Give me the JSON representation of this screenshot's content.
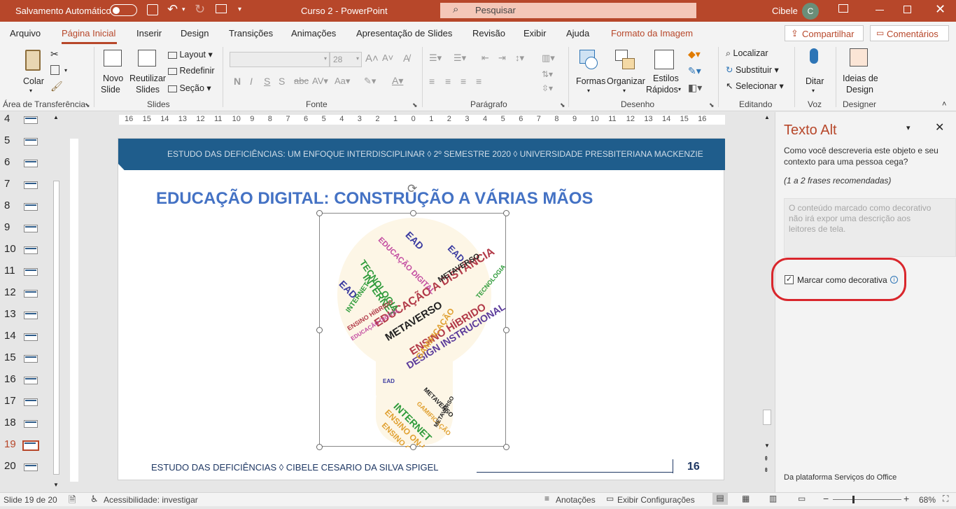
{
  "titlebar": {
    "autosave_label": "Salvamento Automático",
    "doc_title": "Curso 2  -  PowerPoint",
    "search_placeholder": "Pesquisar",
    "user_name": "Cibele",
    "user_initial": "C"
  },
  "tabs": [
    "Arquivo",
    "Página Inicial",
    "Inserir",
    "Design",
    "Transições",
    "Animações",
    "Apresentação de Slides",
    "Revisão",
    "Exibir",
    "Ajuda",
    "Formato da Imagem"
  ],
  "share_label": "Compartilhar",
  "comments_label": "Comentários",
  "ribbon": {
    "colar": "Colar",
    "novo_slide_1": "Novo",
    "novo_slide_2": "Slide",
    "reutilizar_1": "Reutilizar",
    "reutilizar_2": "Slides",
    "layout": "Layout",
    "redefinir": "Redefinir",
    "secao": "Seção",
    "font_size": "28",
    "formas": "Formas",
    "organizar": "Organizar",
    "estilos_1": "Estilos",
    "estilos_2": "Rápidos",
    "localizar": "Localizar",
    "substituir": "Substituir",
    "selecionar": "Selecionar",
    "ditar": "Ditar",
    "ideias_1": "Ideias de",
    "ideias_2": "Design",
    "groups": {
      "clipboard": "Área de Transferência",
      "slides": "Slides",
      "fonte": "Fonte",
      "paragrafo": "Parágrafo",
      "desenho": "Desenho",
      "editando": "Editando",
      "voz": "Voz",
      "designer": "Designer"
    }
  },
  "thumbnails": [
    "4",
    "5",
    "6",
    "7",
    "8",
    "9",
    "10",
    "11",
    "12",
    "13",
    "14",
    "15",
    "16",
    "17",
    "18",
    "19",
    "20"
  ],
  "active_slide": "19",
  "slide": {
    "header": "ESTUDO DAS DEFICIÊNCIAS: UM ENFOQUE INTERDISCIPLINAR  ◊  2º SEMESTRE 2020  ◊  UNIVERSIDADE PRESBITERIANA MACKENZIE",
    "title": "EDUCAÇÃO DIGITAL: CONSTRUÇÃO A VÁRIAS MÃOS",
    "footer": "ESTUDO DAS DEFICIÊNCIAS ◊  CIBELE CESARIO DA SILVA SPIGEL",
    "page_number": "16",
    "words": [
      "EDUCAÇÃO A DISTÂNCIA",
      "METAVERSO",
      "ENSINO HÍBRIDO",
      "DESIGN INSTRUCIONAL",
      "TECNOLOGIA",
      "INTERNET",
      "EAD",
      "GAMIFICAÇÃO",
      "ENSINO ON-LINE",
      "EDUCAÇÃO DIGITAL"
    ]
  },
  "ruler_numbers": [
    "16",
    "15",
    "14",
    "13",
    "12",
    "11",
    "10",
    "9",
    "8",
    "7",
    "6",
    "5",
    "4",
    "3",
    "2",
    "1",
    "0",
    "1",
    "2",
    "3",
    "4",
    "5",
    "6",
    "7",
    "8",
    "9",
    "10",
    "11",
    "12",
    "13",
    "14",
    "15",
    "16"
  ],
  "alt_pane": {
    "title": "Texto Alt",
    "question": "Como você descreveria este objeto e seu contexto para uma pessoa cega?",
    "hint": "(1 a 2 frases recomendadas)",
    "placeholder": "O conteúdo marcado como decorativo não irá expor uma descrição aos leitores de tela.",
    "checkbox_label": "Marcar como decorativa",
    "footer": "Da plataforma Serviços do Office"
  },
  "status": {
    "slide_info": "Slide 19 de 20",
    "accessibility": "Acessibilidade: investigar",
    "notes": "Anotações",
    "display": "Exibir Configurações",
    "zoom": "68%"
  },
  "colors": {
    "accent": "#b7472a",
    "slide_blue": "#1f5d8c",
    "title_blue": "#4472c4",
    "highlight_circle": "#d9262c"
  }
}
